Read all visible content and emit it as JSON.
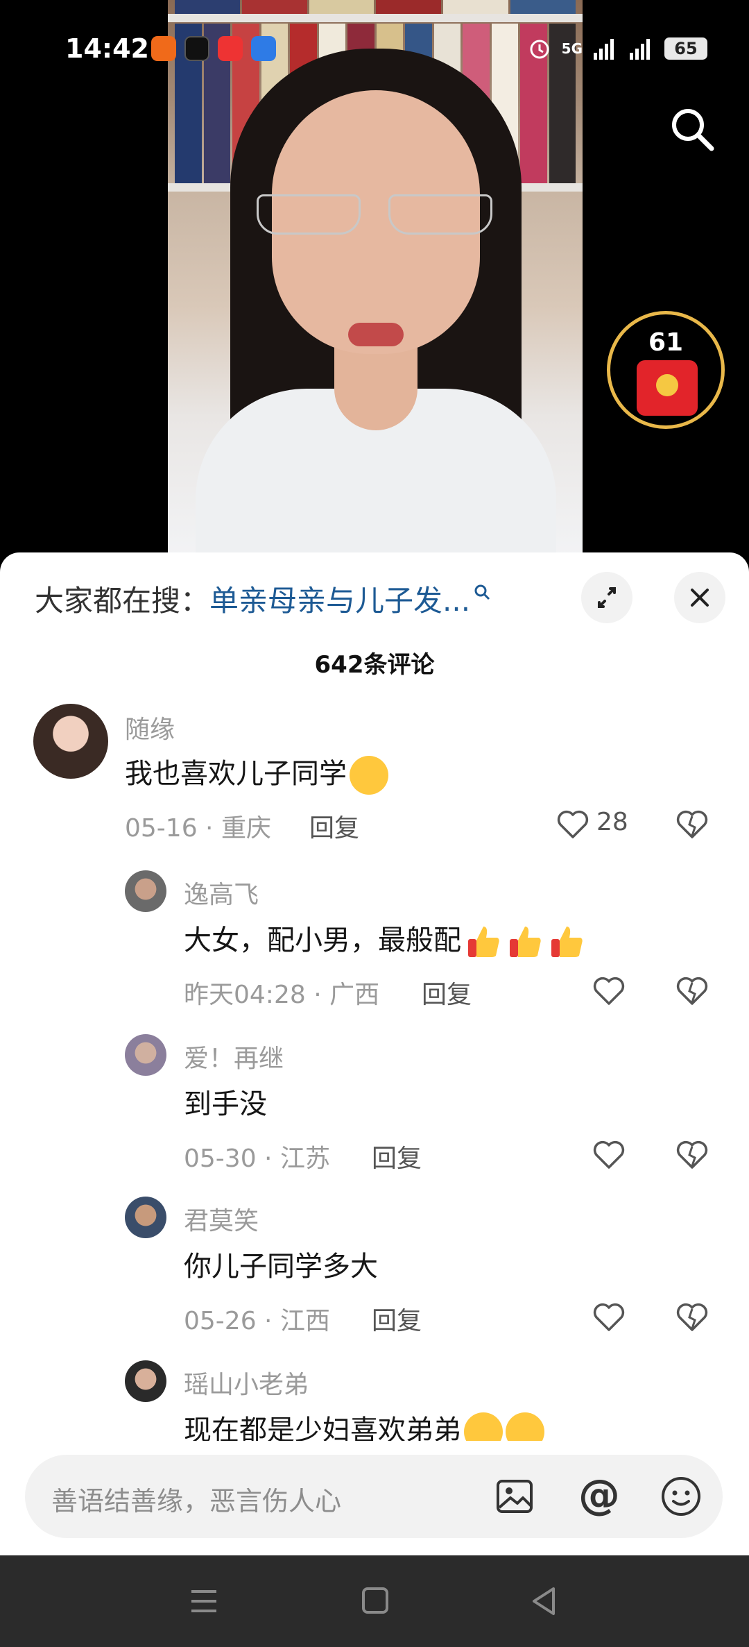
{
  "status_bar": {
    "time": "14:42",
    "battery": "65",
    "network": "5G"
  },
  "red_packet": {
    "count": "61"
  },
  "sheet": {
    "hot_search_label": "大家都在搜：",
    "hot_search_query": "单亲母亲与儿子发...",
    "comment_count": "642条评论"
  },
  "comments": [
    {
      "name": "随缘",
      "text": "我也喜欢儿子同学",
      "date": "05-16 · 重庆",
      "reply": "回复",
      "likes": "28",
      "emoji": "smile"
    },
    {
      "name": "逸高飞",
      "text": "大女，配小男，最般配",
      "date": "昨天04:28 · 广西",
      "reply": "回复",
      "emoji": "thumbs-up x3"
    },
    {
      "name": "爱！再继",
      "text": "到手没",
      "date": "05-30 · 江苏",
      "reply": "回复"
    },
    {
      "name": "君莫笑",
      "text": "你儿子同学多大",
      "date": "05-26 · 江西",
      "reply": "回复"
    },
    {
      "name": "瑶山小老弟",
      "text": "现在都是少妇喜欢弟弟",
      "emoji": "laugh x2"
    }
  ],
  "input": {
    "placeholder": "善语结善缘，恶言伤人心"
  },
  "colors": {
    "link": "#1d5a94",
    "red_packet": "#e2242a",
    "ring": "#e9b84a"
  }
}
